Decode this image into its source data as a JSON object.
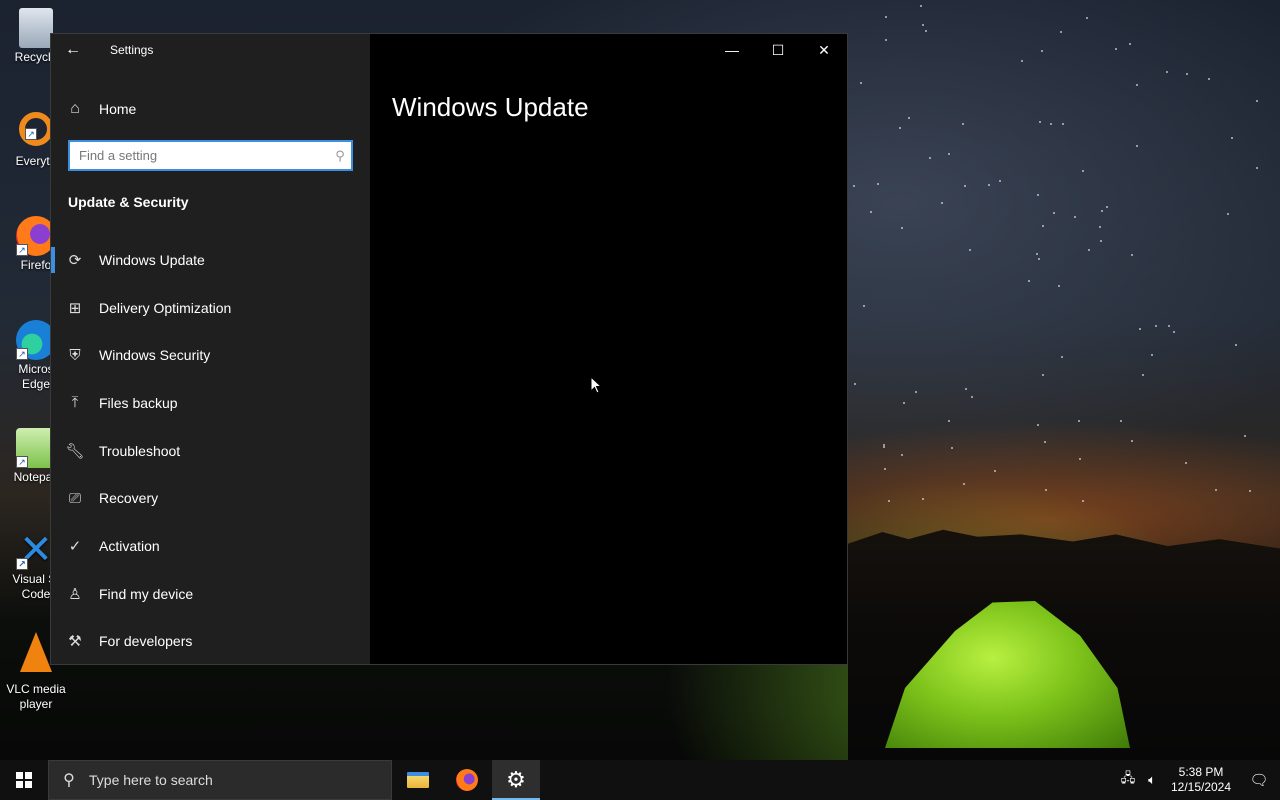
{
  "desktop": {
    "icons": [
      {
        "label": "Recycle",
        "icon": "recycle-bin-icon"
      },
      {
        "label": "Everyth",
        "icon": "everything-search-icon"
      },
      {
        "label": "Firefo",
        "icon": "firefox-icon"
      },
      {
        "label": "Micros Edge",
        "icon": "edge-icon"
      },
      {
        "label": "Notepac",
        "icon": "notepad-plus-plus-icon"
      },
      {
        "label": "Visual St Code",
        "icon": "vscode-icon"
      },
      {
        "label": "VLC media player",
        "icon": "vlc-icon"
      }
    ]
  },
  "window": {
    "title": "Settings",
    "home_label": "Home",
    "search_placeholder": "Find a setting",
    "section_title": "Update & Security",
    "nav_items": [
      {
        "label": "Windows Update",
        "icon": "sync-icon",
        "active": true
      },
      {
        "label": "Delivery Optimization",
        "icon": "delivery-optimization-icon"
      },
      {
        "label": "Windows Security",
        "icon": "shield-icon"
      },
      {
        "label": "Files backup",
        "icon": "upload-arrow-icon"
      },
      {
        "label": "Troubleshoot",
        "icon": "wrench-icon"
      },
      {
        "label": "Recovery",
        "icon": "recovery-icon"
      },
      {
        "label": "Activation",
        "icon": "check-circle-icon"
      },
      {
        "label": "Find my device",
        "icon": "person-location-icon"
      },
      {
        "label": "For developers",
        "icon": "developer-tools-icon"
      }
    ],
    "page_title": "Windows Update",
    "controls": {
      "minimize": "—",
      "maximize": "☐",
      "close": "✕"
    }
  },
  "taskbar": {
    "search_placeholder": "Type here to search",
    "apps": [
      "file-explorer-icon",
      "firefox-icon",
      "settings-gear-icon"
    ],
    "time": "5:38 PM",
    "date": "12/15/2024"
  },
  "colors": {
    "accent": "#3c8fe0",
    "sidebar_bg": "#1f1f1f",
    "main_bg": "#000000",
    "taskbar_bg": "#101010"
  }
}
